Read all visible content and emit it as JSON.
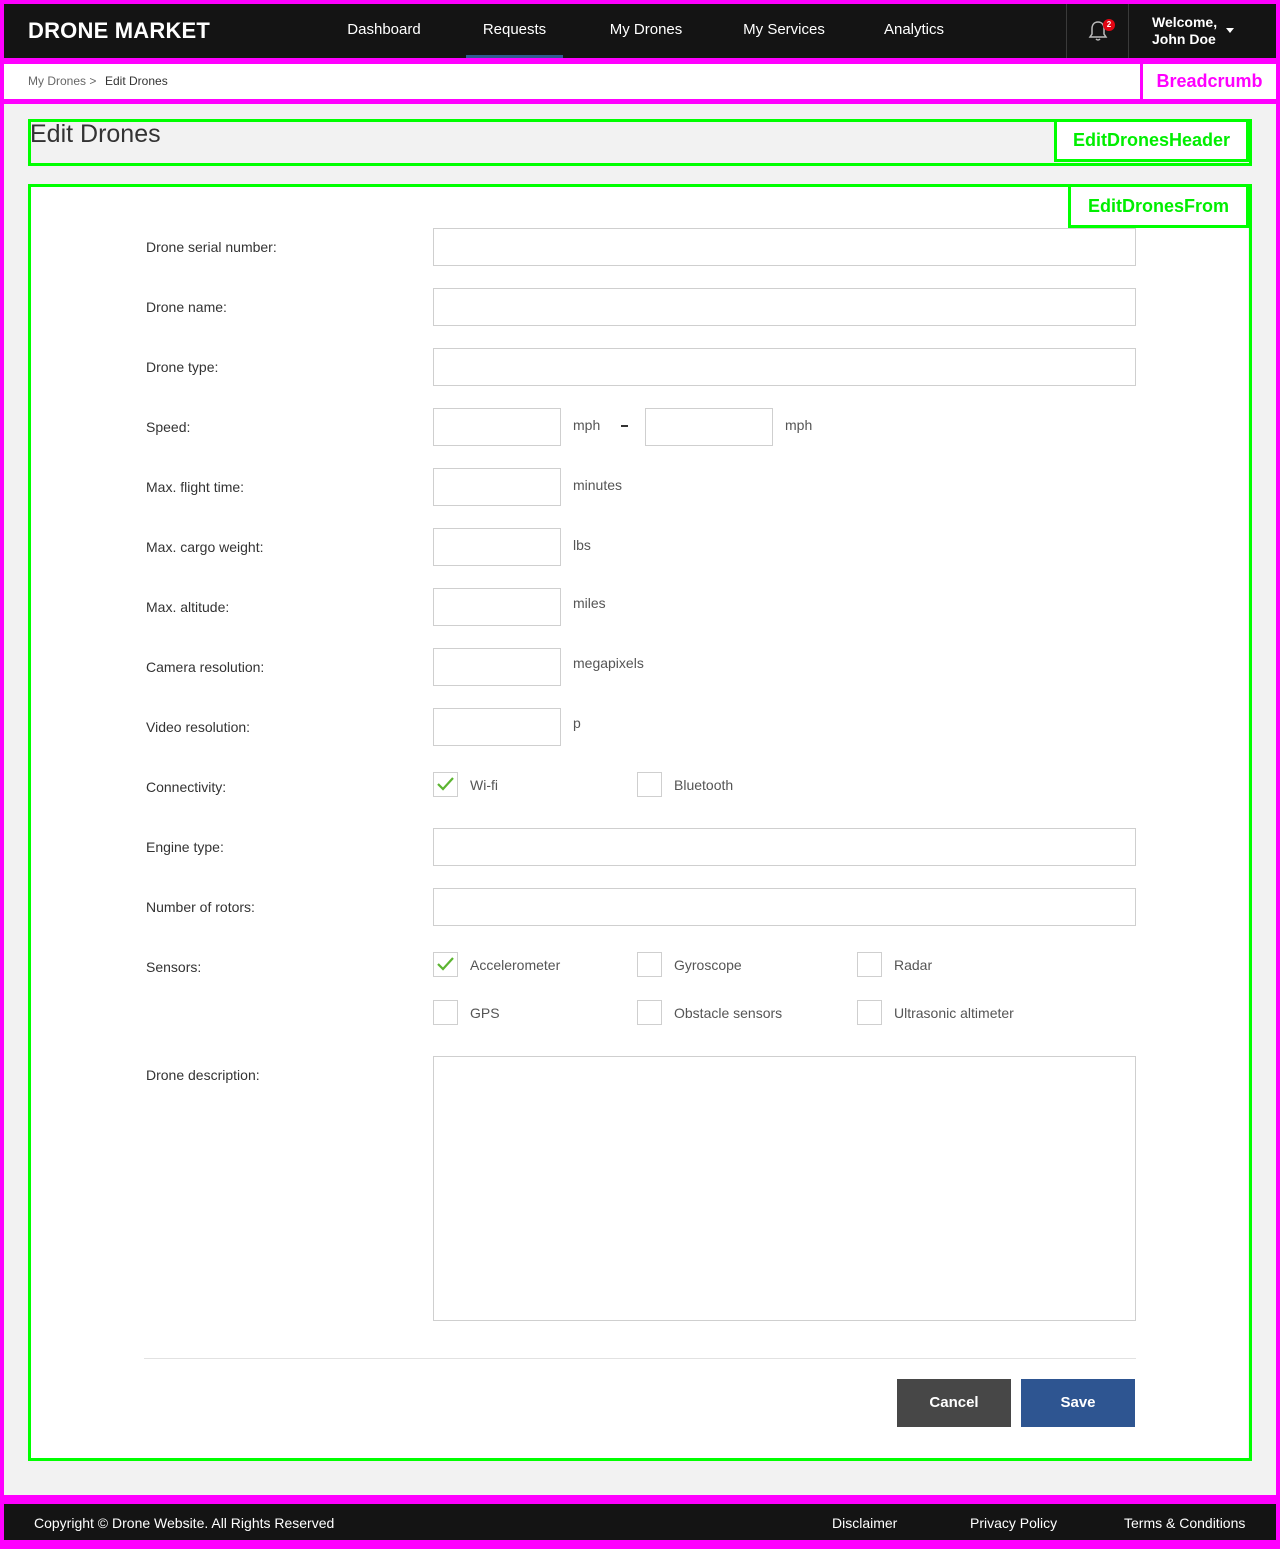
{
  "header": {
    "logo": "DRONE MARKET",
    "nav": [
      "Dashboard",
      "Requests",
      "My Drones",
      "My Services",
      "Analytics"
    ],
    "active_nav": "Requests",
    "notifications": {
      "icon": "bell-icon",
      "count": "2"
    },
    "user": {
      "greeting": "Welcome,",
      "name": "John Doe"
    }
  },
  "breadcrumb": {
    "items": [
      "My Drones >",
      "Edit Drones"
    ],
    "annotation": "Breadcrumb"
  },
  "page": {
    "title": "Edit Drones",
    "header_annotation": "EditDronesHeader",
    "form_annotation": "EditDronesFrom"
  },
  "form": {
    "serial_label": "Drone serial number:",
    "name_label": "Drone name:",
    "type_label": "Drone type:",
    "speed_label": "Speed:",
    "speed_unit": "mph",
    "flight_time_label": "Max. flight time:",
    "flight_time_unit": "minutes",
    "cargo_label": "Max. cargo weight:",
    "cargo_unit": "lbs",
    "altitude_label": "Max. altitude:",
    "altitude_unit": "miles",
    "camera_label": "Camera resolution:",
    "camera_unit": "megapixels",
    "video_label": "Video resolution:",
    "video_unit": "p",
    "connectivity_label": "Connectivity:",
    "connectivity": [
      {
        "label": "Wi-fi",
        "checked": true
      },
      {
        "label": "Bluetooth",
        "checked": false
      }
    ],
    "engine_label": "Engine type:",
    "rotors_label": "Number of rotors:",
    "sensors_label": "Sensors:",
    "sensors": [
      {
        "label": "Accelerometer",
        "checked": true
      },
      {
        "label": "Gyroscope",
        "checked": false
      },
      {
        "label": "Radar",
        "checked": false
      },
      {
        "label": "GPS",
        "checked": false
      },
      {
        "label": "Obstacle sensors",
        "checked": false
      },
      {
        "label": "Ultrasonic altimeter",
        "checked": false
      }
    ],
    "description_label": "Drone description:",
    "cancel_label": "Cancel",
    "save_label": "Save"
  },
  "footer": {
    "copyright": "Copyright © Drone Website. All Rights Reserved",
    "links": [
      "Disclaimer",
      "Privacy Policy",
      "Terms & Conditions"
    ]
  },
  "colors": {
    "annotation_magenta": "#ff00ff",
    "annotation_green": "#00ff00",
    "primary": "#2e5591",
    "check": "#5cb531",
    "badge": "#e30613"
  }
}
